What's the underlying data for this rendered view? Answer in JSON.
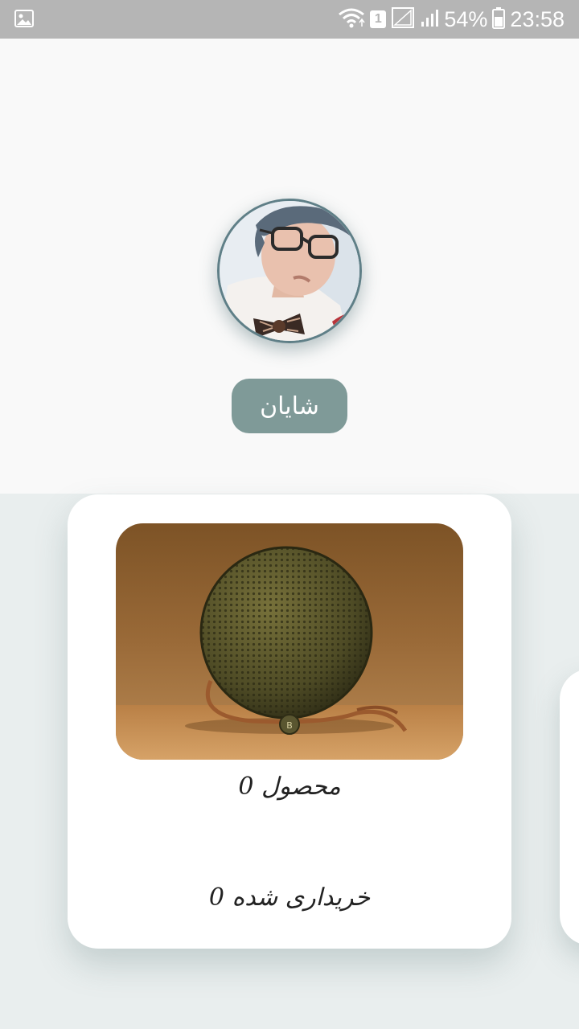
{
  "status_bar": {
    "battery_percent": "54%",
    "time": "23:58",
    "sim_slot": "1",
    "icons": [
      "gallery-icon",
      "wifi-icon",
      "sim-badge",
      "signal-outline-icon",
      "signal-icon",
      "battery-icon"
    ]
  },
  "profile": {
    "name": "شایان",
    "avatar": "user-photo",
    "accent_color": "#7f9a98",
    "avatar_border_color": "#5f7f87"
  },
  "cards": [
    {
      "image": "bluetooth-speaker-photo",
      "products_label": "محصول 0",
      "purchased_label": "خریداری شده 0"
    }
  ]
}
